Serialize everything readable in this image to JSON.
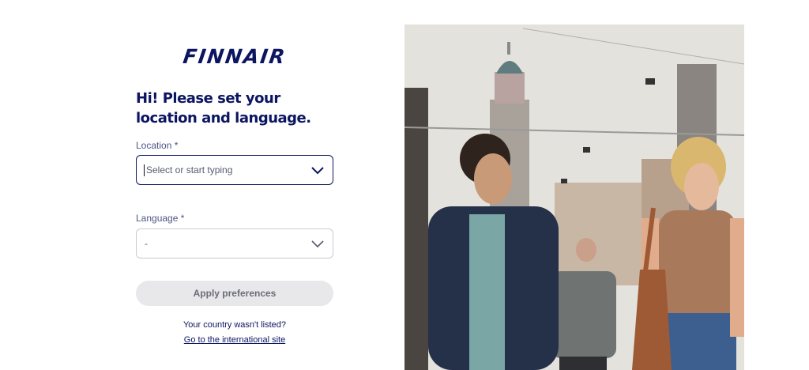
{
  "brand": {
    "logo_text": "FINNAIR"
  },
  "heading": "Hi! Please set your location and language.",
  "location": {
    "label": "Location *",
    "placeholder": "Select or start typing"
  },
  "language": {
    "label": "Language *",
    "value": "-"
  },
  "apply_button": "Apply preferences",
  "footer": {
    "note": "Your country wasn't listed?",
    "link": "Go to the international site"
  },
  "icons": {
    "dropdown": "chevron-down-icon"
  },
  "colors": {
    "brand": "#0b1560",
    "button_bg": "#e8e8ea"
  }
}
